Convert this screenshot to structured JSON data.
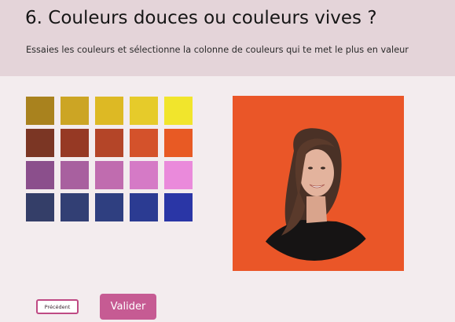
{
  "header": {
    "title": "6. Couleurs douces ou couleurs vives ?",
    "subtitle": "Essaies les couleurs et sélectionne la colonne de couleurs qui te met le plus en valeur"
  },
  "palette": {
    "rows": [
      [
        "#a9821e",
        "#cca524",
        "#ddb924",
        "#e6cb2a",
        "#f1e52c"
      ],
      [
        "#7b3624",
        "#963924",
        "#b44528",
        "#d4522b",
        "#e85a24"
      ],
      [
        "#8b4f8c",
        "#a8609f",
        "#c06caf",
        "#d57ac6",
        "#ea8adb"
      ],
      [
        "#343e68",
        "#323f74",
        "#2f3f80",
        "#2b3b92",
        "#2a36a6"
      ]
    ]
  },
  "preview": {
    "background_color": "#ea5628",
    "icon": "portrait-photo"
  },
  "buttons": {
    "previous_label": "Précédent",
    "validate_label": "Valider"
  }
}
